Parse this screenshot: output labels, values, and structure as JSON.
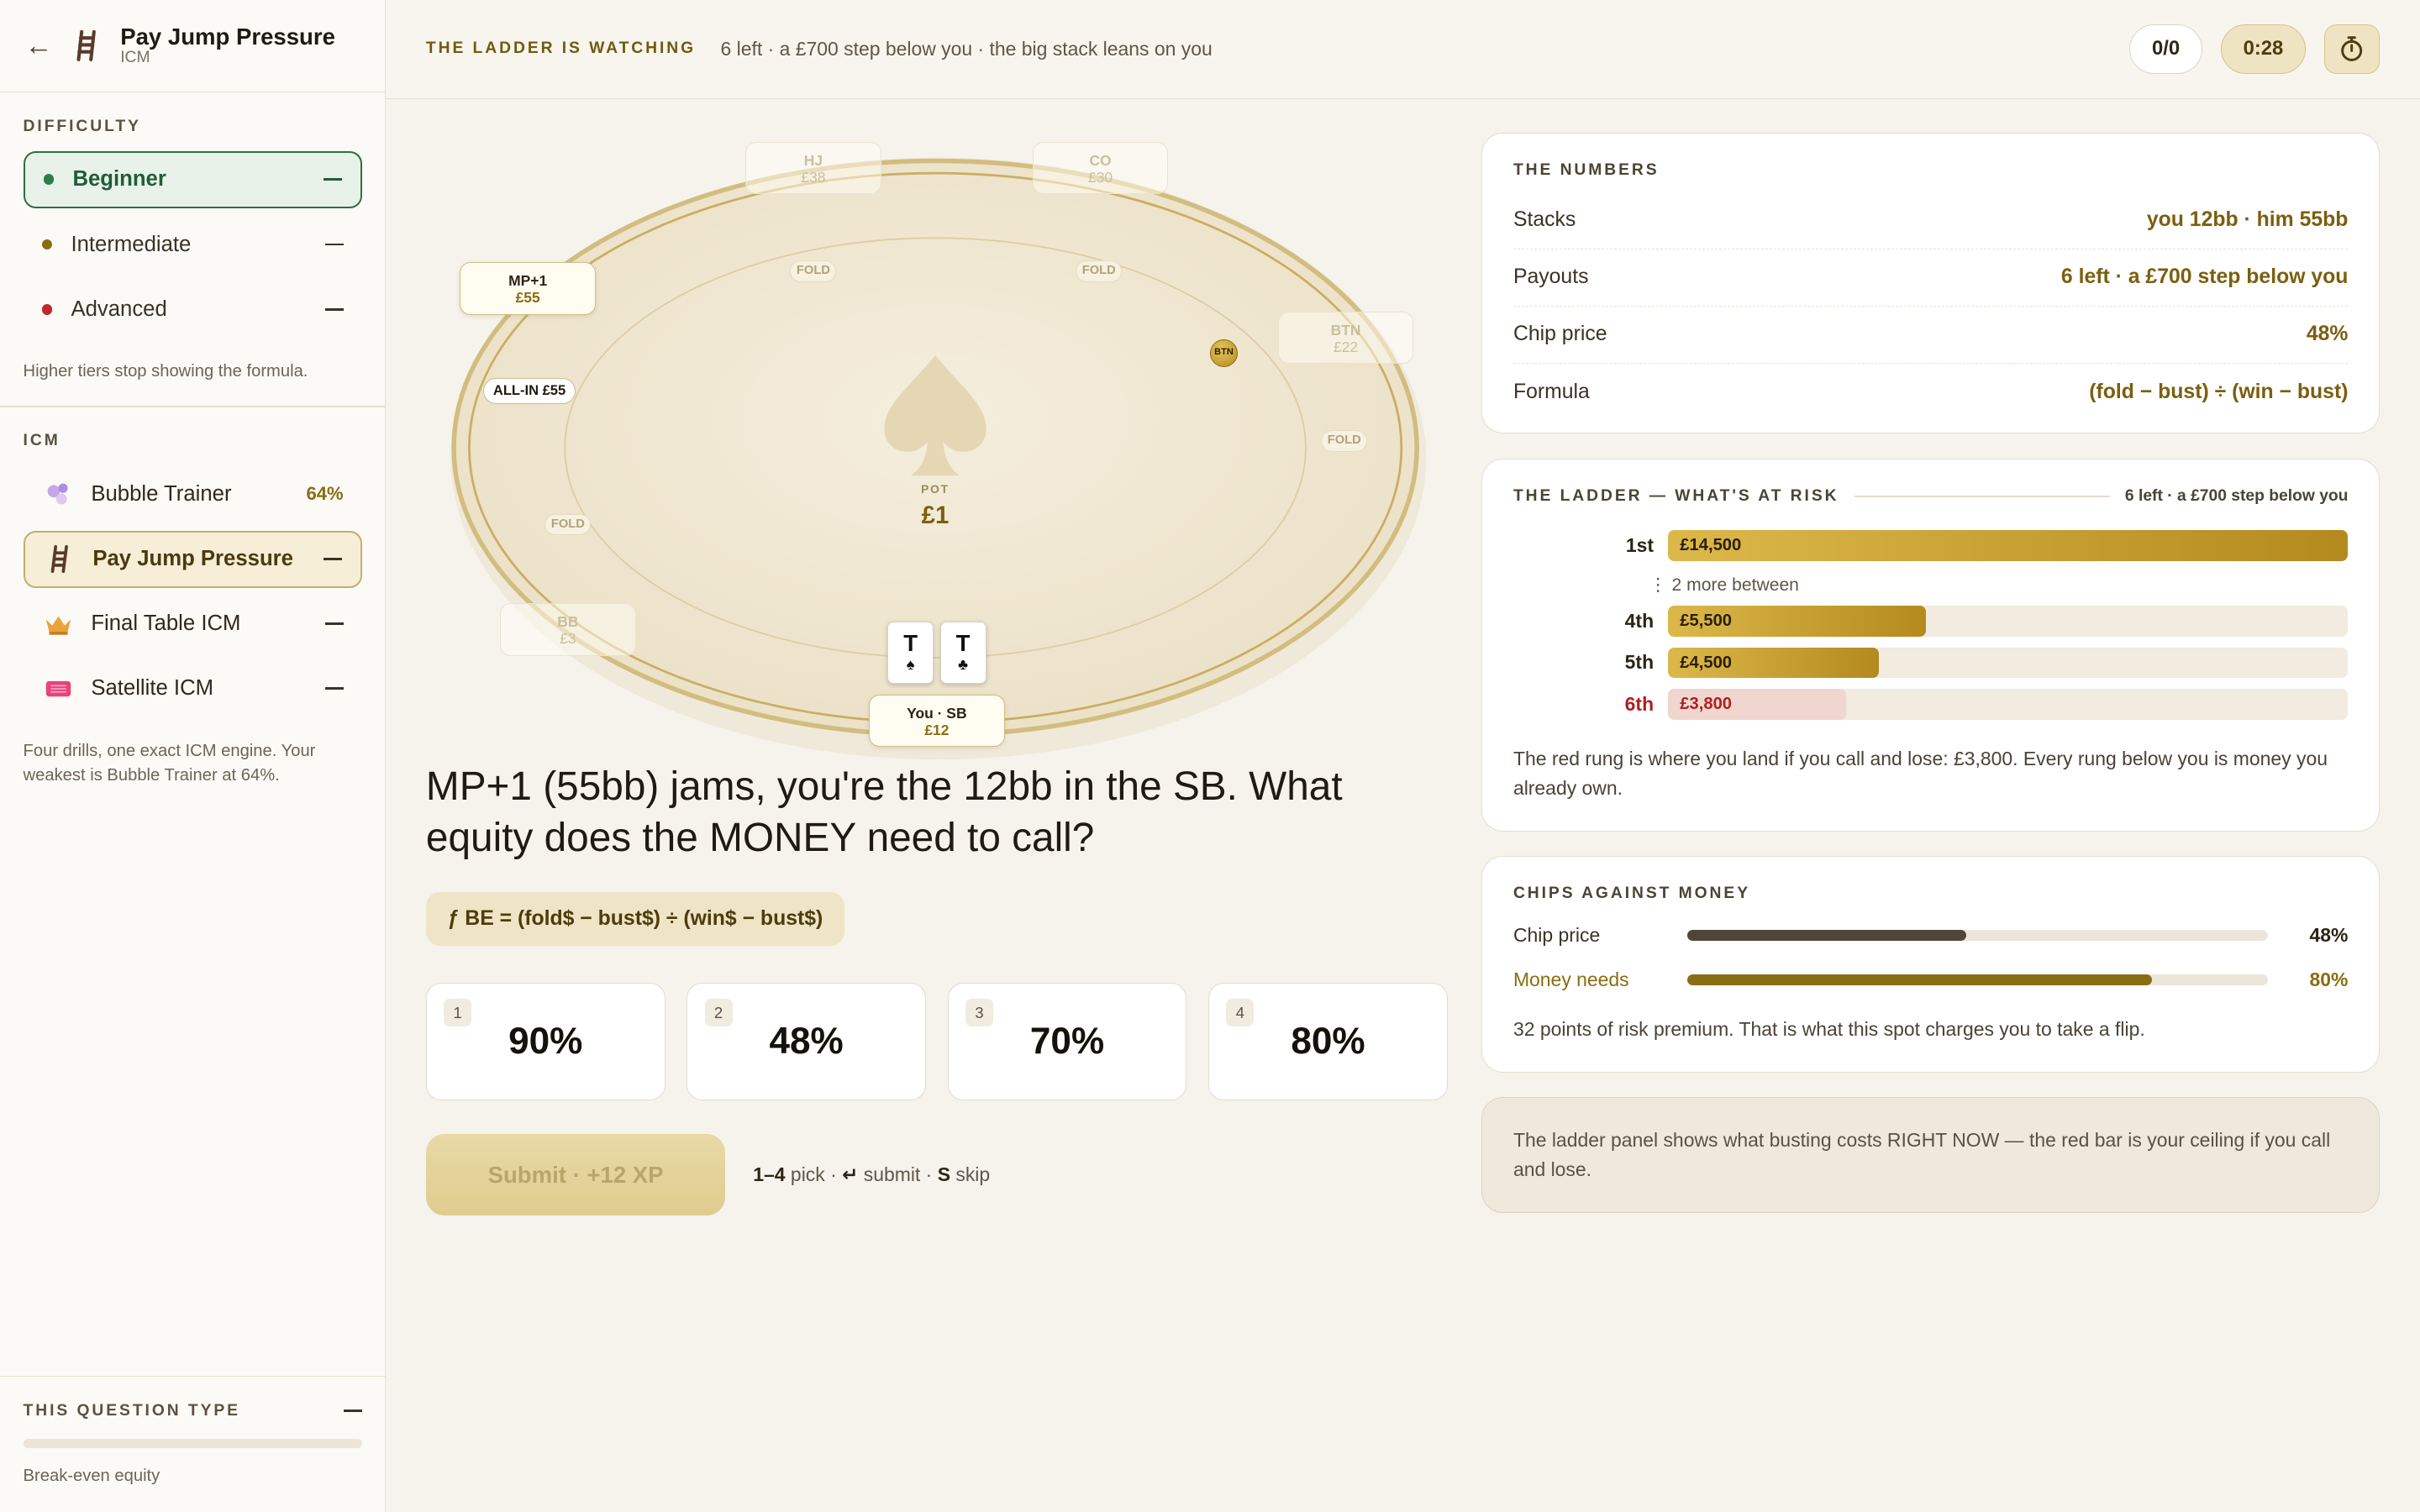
{
  "sidebar": {
    "title": "Pay Jump Pressure",
    "subtitle": "ICM",
    "difficulty_label": "DIFFICULTY",
    "tiers": [
      {
        "label": "Beginner",
        "color": "#2e7d4f",
        "active": true
      },
      {
        "label": "Intermediate",
        "color": "#8a6d12",
        "active": false
      },
      {
        "label": "Advanced",
        "color": "#c0282d",
        "active": false
      }
    ],
    "tier_note": "Higher tiers stop showing the formula.",
    "icm_label": "ICM",
    "drills": [
      {
        "label": "Bubble Trainer",
        "pct": "64%",
        "icon": "bubbles-icon",
        "active": false
      },
      {
        "label": "Pay Jump Pressure",
        "pct": "",
        "icon": "ladder-icon",
        "active": true
      },
      {
        "label": "Final Table ICM",
        "pct": "",
        "icon": "crown-icon",
        "active": false
      },
      {
        "label": "Satellite ICM",
        "pct": "",
        "icon": "ticket-icon",
        "active": false
      }
    ],
    "drill_note": "Four drills, one exact ICM engine. Your weakest is Bubble Trainer at 64%.",
    "foot_label": "THIS QUESTION TYPE",
    "foot_type": "Break-even equity"
  },
  "topbar": {
    "title": "THE LADDER IS WATCHING",
    "subtitle": "6 left · a £700 step below you · the big stack leans on you",
    "score": "0/0",
    "timer": "0:28",
    "timer_icon": "stopwatch-icon"
  },
  "table": {
    "seats": [
      {
        "name": "HJ",
        "stack": "£38",
        "state": "faded"
      },
      {
        "name": "CO",
        "stack": "£30",
        "state": "faded"
      },
      {
        "name": "MP+1",
        "stack": "£55",
        "state": "strong"
      },
      {
        "name": "BTN",
        "stack": "£22",
        "state": "faded"
      },
      {
        "name": "BB",
        "stack": "£3",
        "state": "faded"
      },
      {
        "name": "You · SB",
        "stack": "£12",
        "state": "strong"
      }
    ],
    "fold_label": "FOLD",
    "allin_label": "ALL-IN £55",
    "button_label": "BTN",
    "pot_label": "POT",
    "pot_value": "£1",
    "hole_cards": [
      {
        "rank": "T",
        "suit": "♠"
      },
      {
        "rank": "T",
        "suit": "♣"
      }
    ]
  },
  "question": {
    "text": "MP+1 (55bb) jams, you're the 12bb in the SB. What equity does the MONEY need to call?",
    "formula": "ƒ BE = (fold$ − bust$) ÷ (win$ − bust$)",
    "answers": [
      {
        "key": "1",
        "value": "90%"
      },
      {
        "key": "2",
        "value": "48%"
      },
      {
        "key": "3",
        "value": "70%"
      },
      {
        "key": "4",
        "value": "80%"
      }
    ],
    "submit_label": "Submit · +12 XP",
    "hint_keys": "1–4",
    "hint_pick": " pick · ",
    "hint_enter": "↵",
    "hint_submit": " submit · ",
    "hint_s": "S",
    "hint_skip": " skip"
  },
  "numbers": {
    "title": "THE NUMBERS",
    "rows": [
      {
        "k": "Stacks",
        "v": "you 12bb · him 55bb"
      },
      {
        "k": "Payouts",
        "v": "6 left · a £700 step below you"
      },
      {
        "k": "Chip price",
        "v": "48%"
      },
      {
        "k": "Formula",
        "v": "(fold − bust) ÷ (win − bust)"
      }
    ]
  },
  "ladder": {
    "title": "THE LADDER — WHAT'S AT RISK",
    "note": "6 left · a £700 step below you",
    "between": "2 more between",
    "rungs": [
      {
        "place": "1st",
        "amount": "£14,500",
        "value": 14500,
        "risk": false
      },
      {
        "place": "4th",
        "amount": "£5,500",
        "value": 5500,
        "risk": false
      },
      {
        "place": "5th",
        "amount": "£4,500",
        "value": 4500,
        "risk": false
      },
      {
        "place": "6th",
        "amount": "£3,800",
        "value": 3800,
        "risk": true
      }
    ],
    "text": "The red rung is where you land if you call and lose: £3,800. Every rung below you is money you already own."
  },
  "cvm": {
    "title": "CHIPS AGAINST MONEY",
    "rows": [
      {
        "k": "Chip price",
        "pct": 48,
        "label": "48%",
        "color": "#4f4637"
      },
      {
        "k": "Money needs",
        "pct": 80,
        "label": "80%",
        "color": "#8a6d12"
      }
    ],
    "text": "32 points of risk premium. That is what this spot charges you to take a flip."
  },
  "tip": "The ladder panel shows what busting costs RIGHT NOW — the red bar is your ceiling if you call and lose."
}
